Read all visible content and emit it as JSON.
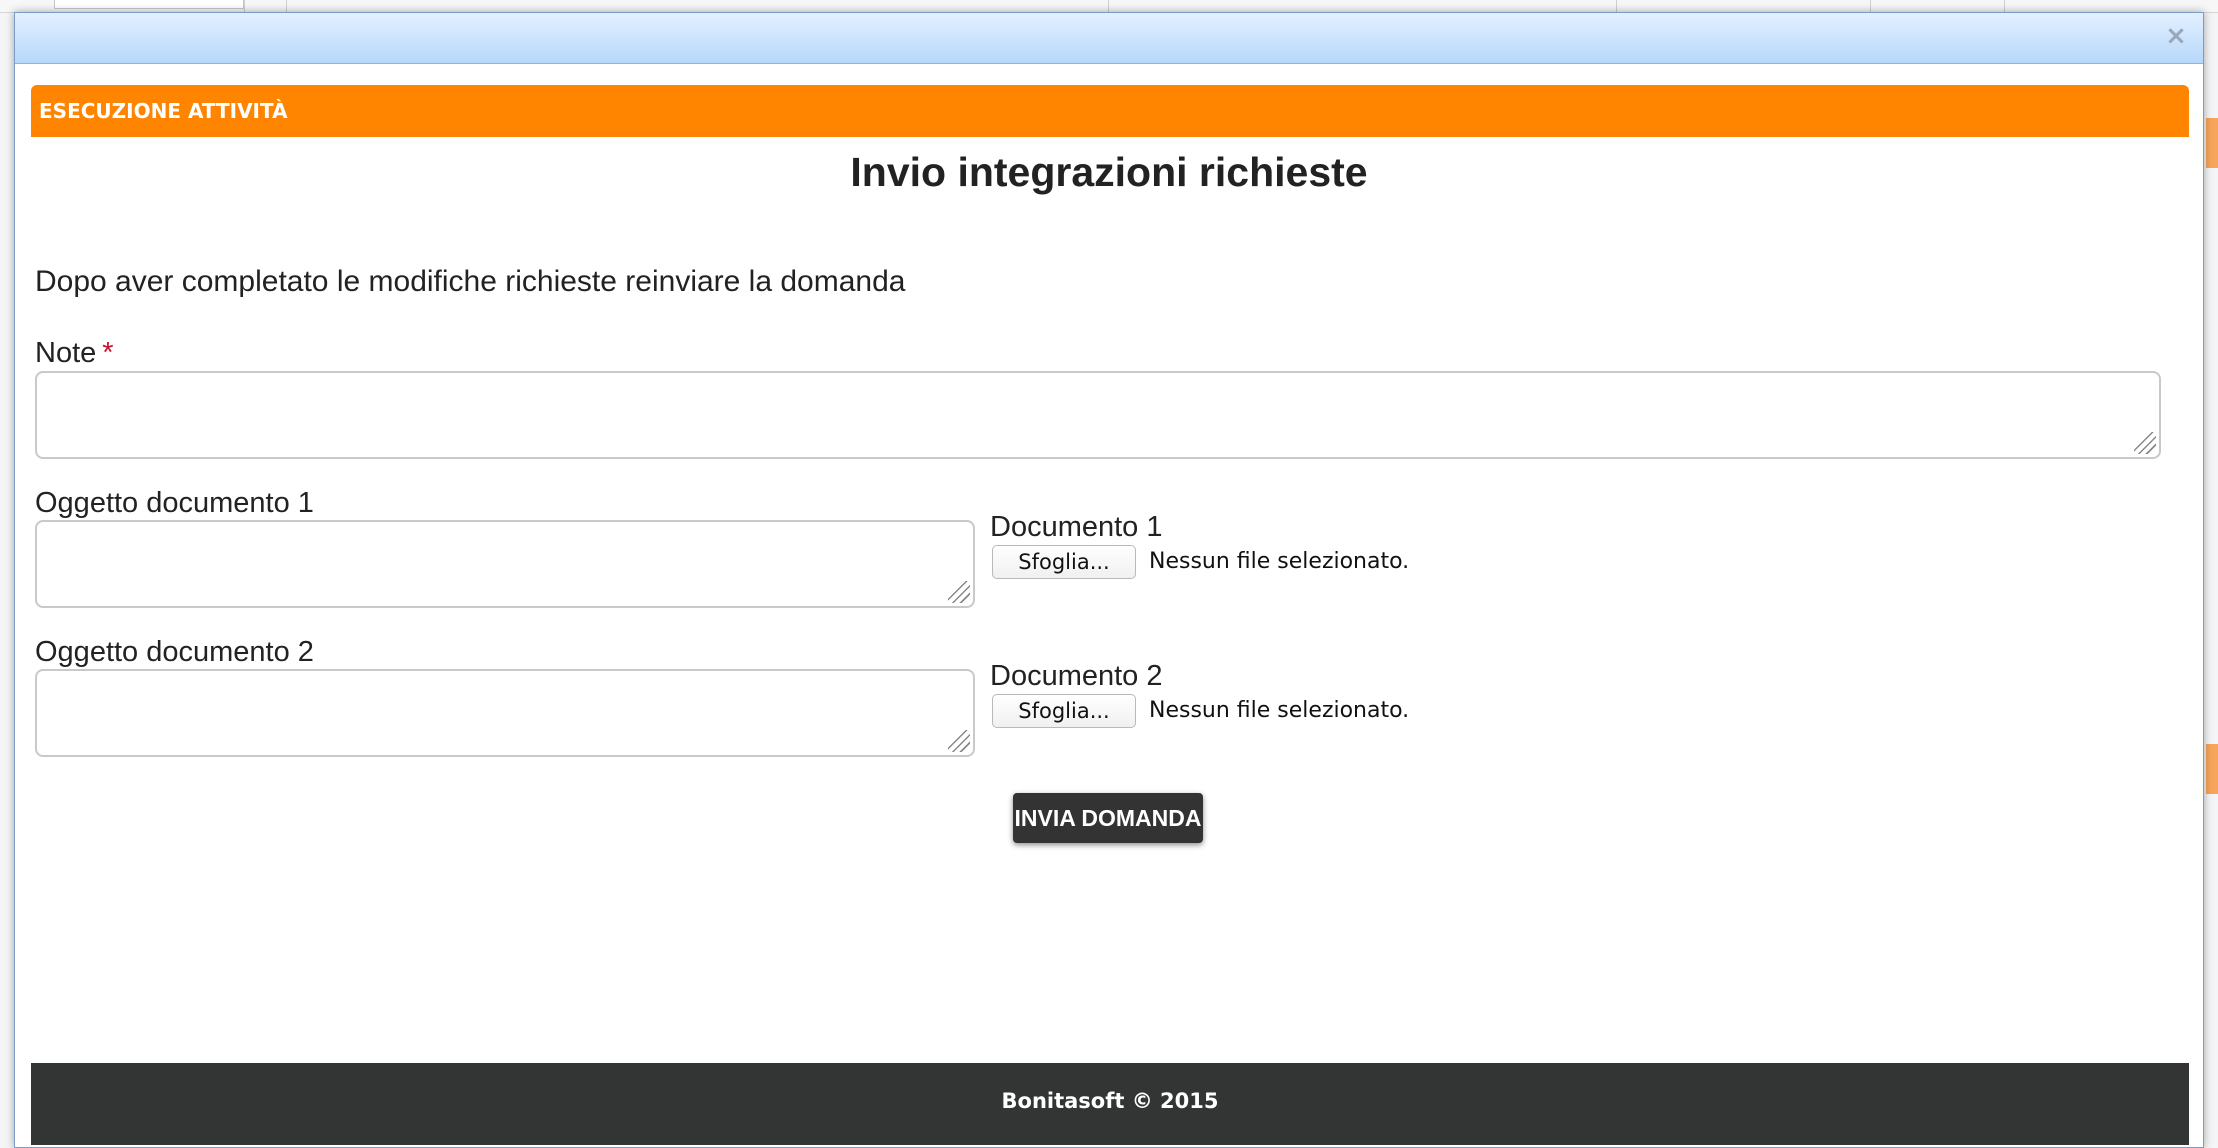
{
  "dialog": {
    "close_icon": "×"
  },
  "task_header": {
    "label": "ESECUZIONE ATTIVITÀ",
    "color": "#ff8400"
  },
  "form": {
    "title": "Invio integrazioni richieste",
    "intro": "Dopo aver completato le modifiche richieste reinviare la domanda",
    "note_label": "Note",
    "required_marker": "*",
    "object_doc1_label": "Oggetto documento 1",
    "object_doc2_label": "Oggetto documento 2",
    "doc1_label": "Documento 1",
    "doc2_label": "Documento 2",
    "browse_label": "Sfoglia...",
    "no_file_text": "Nessun file selezionato.",
    "submit_label": "INVIA DOMANDA"
  },
  "footer": {
    "text": "Bonitasoft © 2015"
  }
}
